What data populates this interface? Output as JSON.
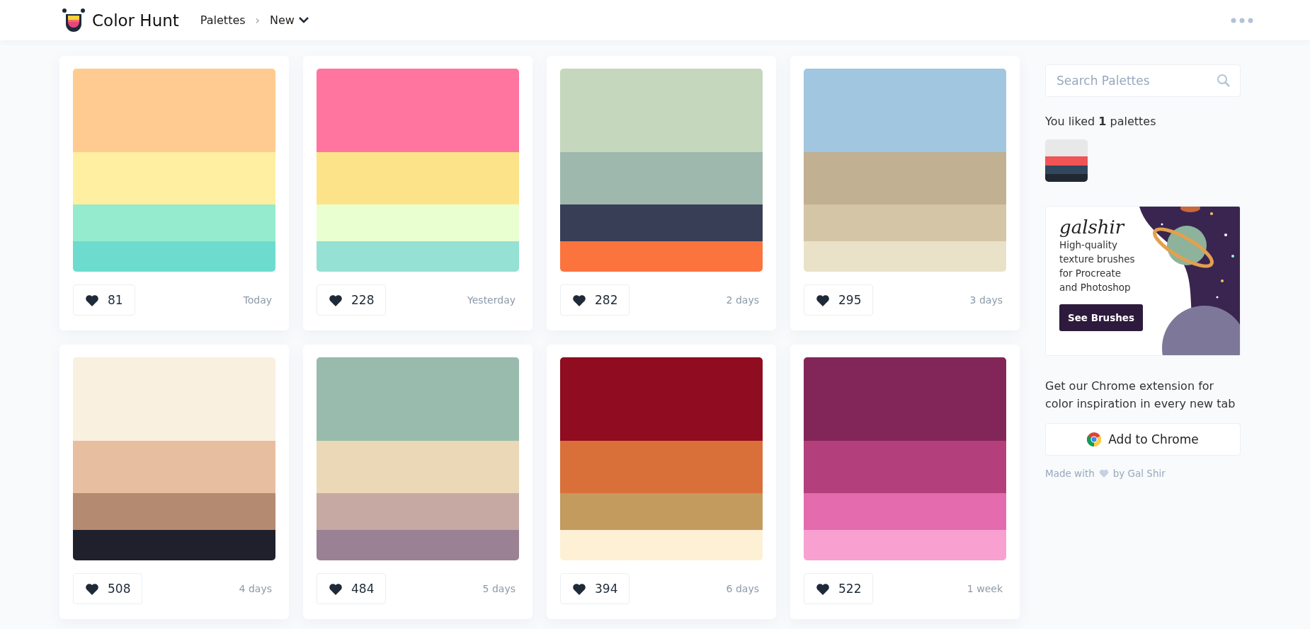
{
  "header": {
    "brand": "Color Hunt",
    "breadcrumb": [
      "Palettes",
      "New"
    ],
    "separator": "›"
  },
  "palettes": [
    {
      "stripes": [
        {
          "color": "#ffcb91"
        },
        {
          "color": "#ffefa1"
        },
        {
          "color": "#94ebcd"
        },
        {
          "color": "#6ddccf"
        }
      ],
      "likes": "81",
      "date": "Today"
    },
    {
      "stripes": [
        {
          "color": "#ff75a0"
        },
        {
          "color": "#fce38a"
        },
        {
          "color": "#eaffd0"
        },
        {
          "color": "#95e1d3"
        }
      ],
      "likes": "228",
      "date": "Yesterday"
    },
    {
      "stripes": [
        {
          "color": "#c5d7bd"
        },
        {
          "color": "#9fb8ad"
        },
        {
          "color": "#383e56"
        },
        {
          "color": "#fb743e"
        }
      ],
      "likes": "282",
      "date": "2 days"
    },
    {
      "stripes": [
        {
          "color": "#a1c6e0"
        },
        {
          "color": "#c1b092"
        },
        {
          "color": "#d3c5a6"
        },
        {
          "color": "#e9e2c8"
        }
      ],
      "likes": "295",
      "date": "3 days"
    },
    {
      "stripes": [
        {
          "color": "#f9f0e0"
        },
        {
          "color": "#e8bea0"
        },
        {
          "color": "#b48a70"
        },
        {
          "color": "#1f202c"
        }
      ],
      "likes": "508",
      "date": "4 days"
    },
    {
      "stripes": [
        {
          "color": "#99bbad"
        },
        {
          "color": "#ebd8b7"
        },
        {
          "color": "#c6a9a3"
        },
        {
          "color": "#9a8194"
        }
      ],
      "likes": "484",
      "date": "5 days"
    },
    {
      "stripes": [
        {
          "color": "#900c20"
        },
        {
          "color": "#d9703a"
        },
        {
          "color": "#c39b5e"
        },
        {
          "color": "#fdf0d5"
        }
      ],
      "likes": "394",
      "date": "6 days"
    },
    {
      "stripes": [
        {
          "color": "#822659"
        },
        {
          "color": "#b3407c"
        },
        {
          "color": "#e36bae"
        },
        {
          "color": "#f8a1d1"
        }
      ],
      "likes": "522",
      "date": "1 week"
    }
  ],
  "sidebar": {
    "search": {
      "placeholder": "Search Palettes"
    },
    "liked_text": "You liked **1** palettes",
    "liked": [
      {
        "stripes": [
          {
            "color": "#e8e8e8"
          },
          {
            "color": "#f05454"
          },
          {
            "color": "#30475e"
          },
          {
            "color": "#222831"
          }
        ]
      }
    ],
    "ad": {
      "logo": "galshir",
      "lines": [
        "High-quality",
        "texture brushes",
        "for Procreate",
        "and Photoshop"
      ],
      "button": "See Brushes",
      "kind": "picture"
    },
    "extension_text": "Get our Chrome extension for color inspiration in every new tab",
    "chrome_button": "Add to Chrome",
    "credit": [
      "Made with",
      "by Gal Shir"
    ]
  }
}
